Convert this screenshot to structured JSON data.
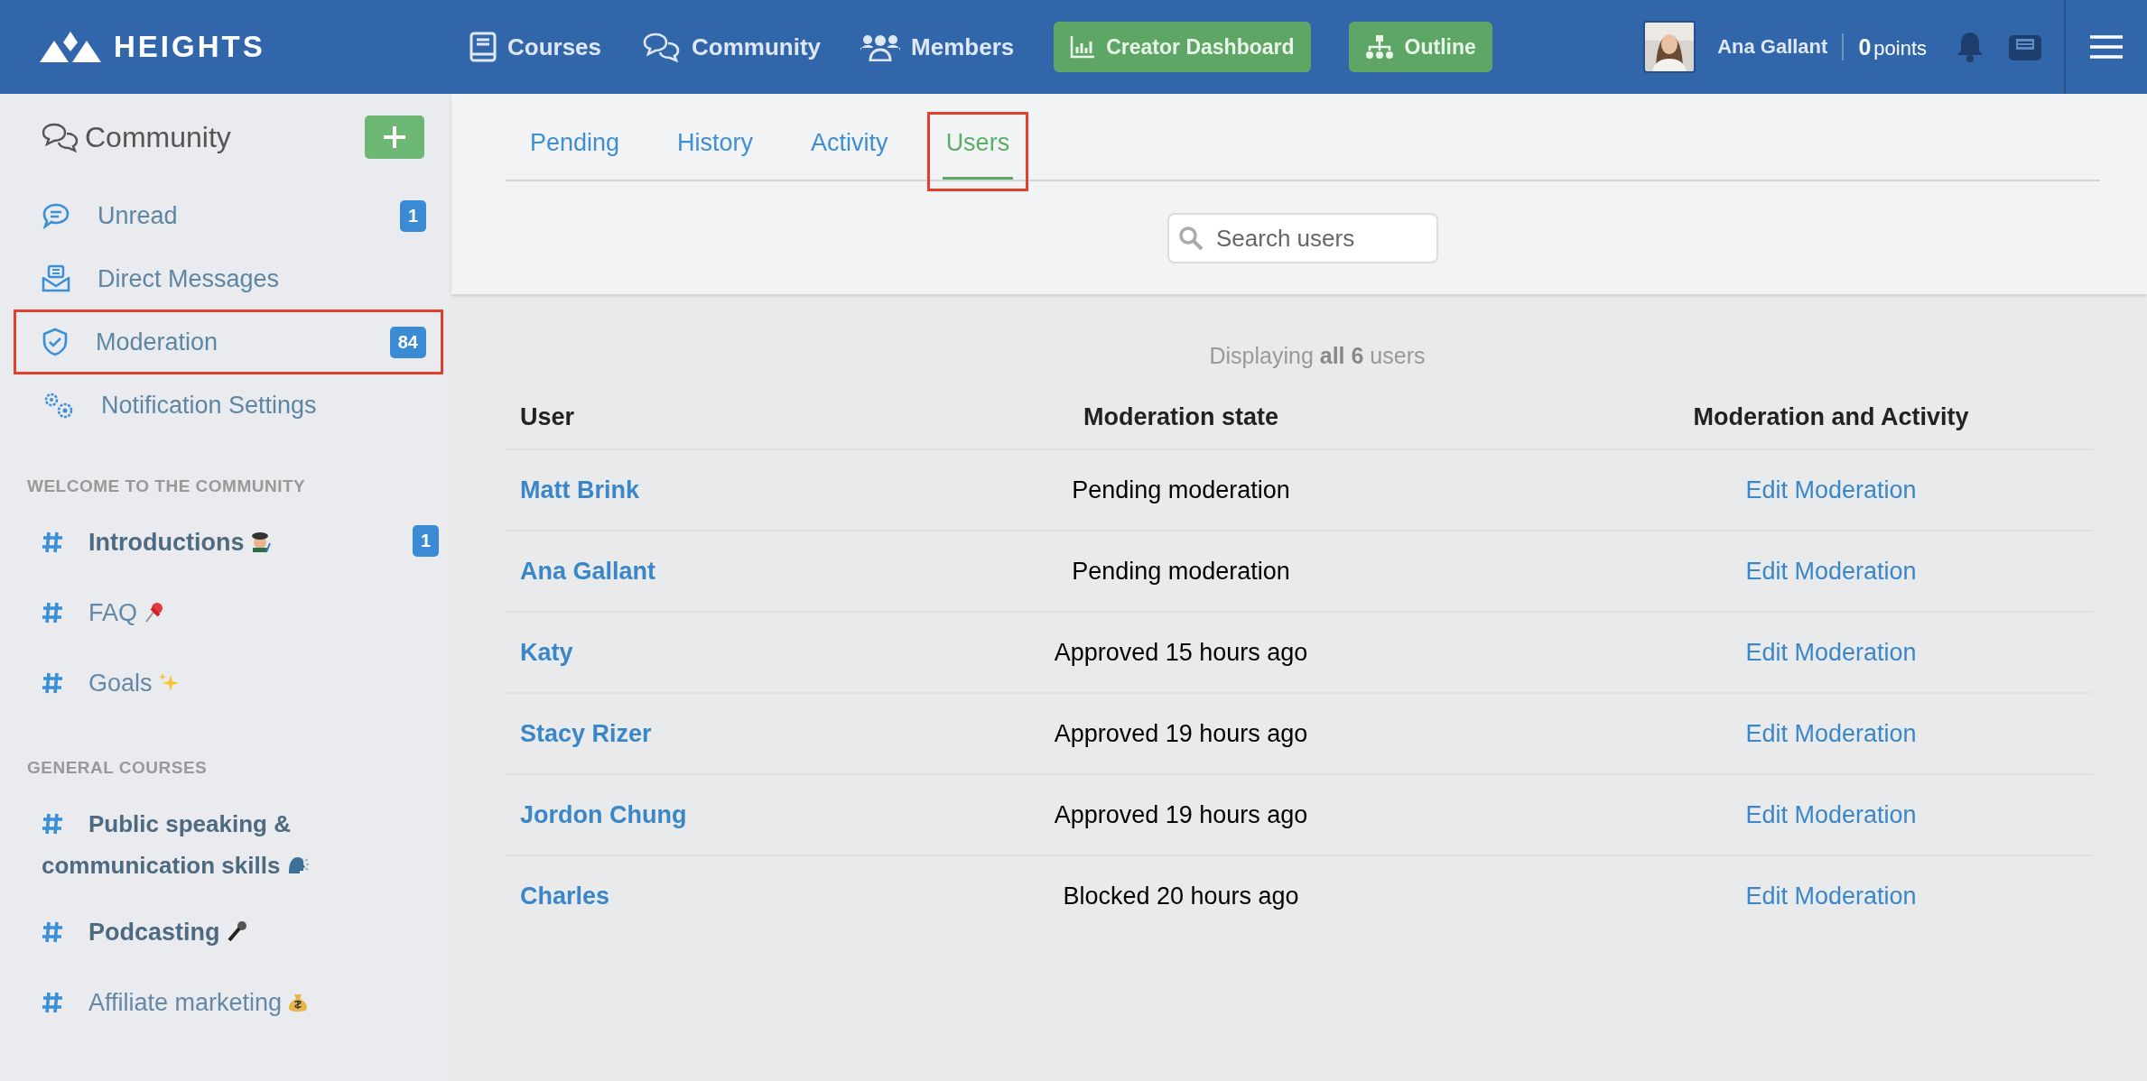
{
  "header": {
    "logo": "HEIGHTS",
    "nav": [
      {
        "label": "Courses"
      },
      {
        "label": "Community"
      },
      {
        "label": "Members"
      }
    ],
    "buttons": [
      {
        "label": "Creator Dashboard"
      },
      {
        "label": "Outline"
      }
    ],
    "user": {
      "name": "Ana Gallant",
      "points_value": "0",
      "points_label": "points"
    }
  },
  "sidebar": {
    "title": "Community",
    "items": [
      {
        "label": "Unread",
        "badge": "1",
        "highlighted": false
      },
      {
        "label": "Direct Messages",
        "highlighted": false
      },
      {
        "label": "Moderation",
        "badge": "84",
        "highlighted": true
      },
      {
        "label": "Notification Settings",
        "highlighted": false
      }
    ],
    "sections": [
      {
        "heading": "WELCOME TO THE COMMUNITY",
        "channels": [
          {
            "label": "Introductions",
            "badge": "1",
            "unread": true
          },
          {
            "label": "FAQ",
            "unread": false
          },
          {
            "label": "Goals",
            "unread": false
          }
        ]
      },
      {
        "heading": "GENERAL COURSES",
        "channels": [
          {
            "label": "Public speaking & communication skills",
            "unread": true
          },
          {
            "label": "Podcasting",
            "unread": true
          },
          {
            "label": "Affiliate marketing",
            "unread": false
          }
        ]
      }
    ]
  },
  "tabs": [
    {
      "label": "Pending",
      "selected": false,
      "highlighted": false
    },
    {
      "label": "History",
      "selected": false,
      "highlighted": false
    },
    {
      "label": "Activity",
      "selected": false,
      "highlighted": false
    },
    {
      "label": "Users",
      "selected": true,
      "highlighted": true
    }
  ],
  "search": {
    "placeholder": "Search users"
  },
  "summary": "Displaying **all 6** users",
  "table": {
    "columns": [
      "User",
      "Moderation state",
      "Moderation and Activity"
    ],
    "rows": [
      {
        "user": "Matt Brink",
        "state": "Pending moderation",
        "action": "Edit Moderation"
      },
      {
        "user": "Ana Gallant",
        "state": "Pending moderation",
        "action": "Edit Moderation"
      },
      {
        "user": "Katy",
        "state": "Approved 15 hours ago",
        "action": "Edit Moderation"
      },
      {
        "user": "Stacy Rizer",
        "state": "Approved 19 hours ago",
        "action": "Edit Moderation"
      },
      {
        "user": "Jordon Chung",
        "state": "Approved 19 hours ago",
        "action": "Edit Moderation"
      },
      {
        "user": "Charles",
        "state": "Blocked 20 hours ago",
        "action": "Edit Moderation"
      }
    ]
  }
}
